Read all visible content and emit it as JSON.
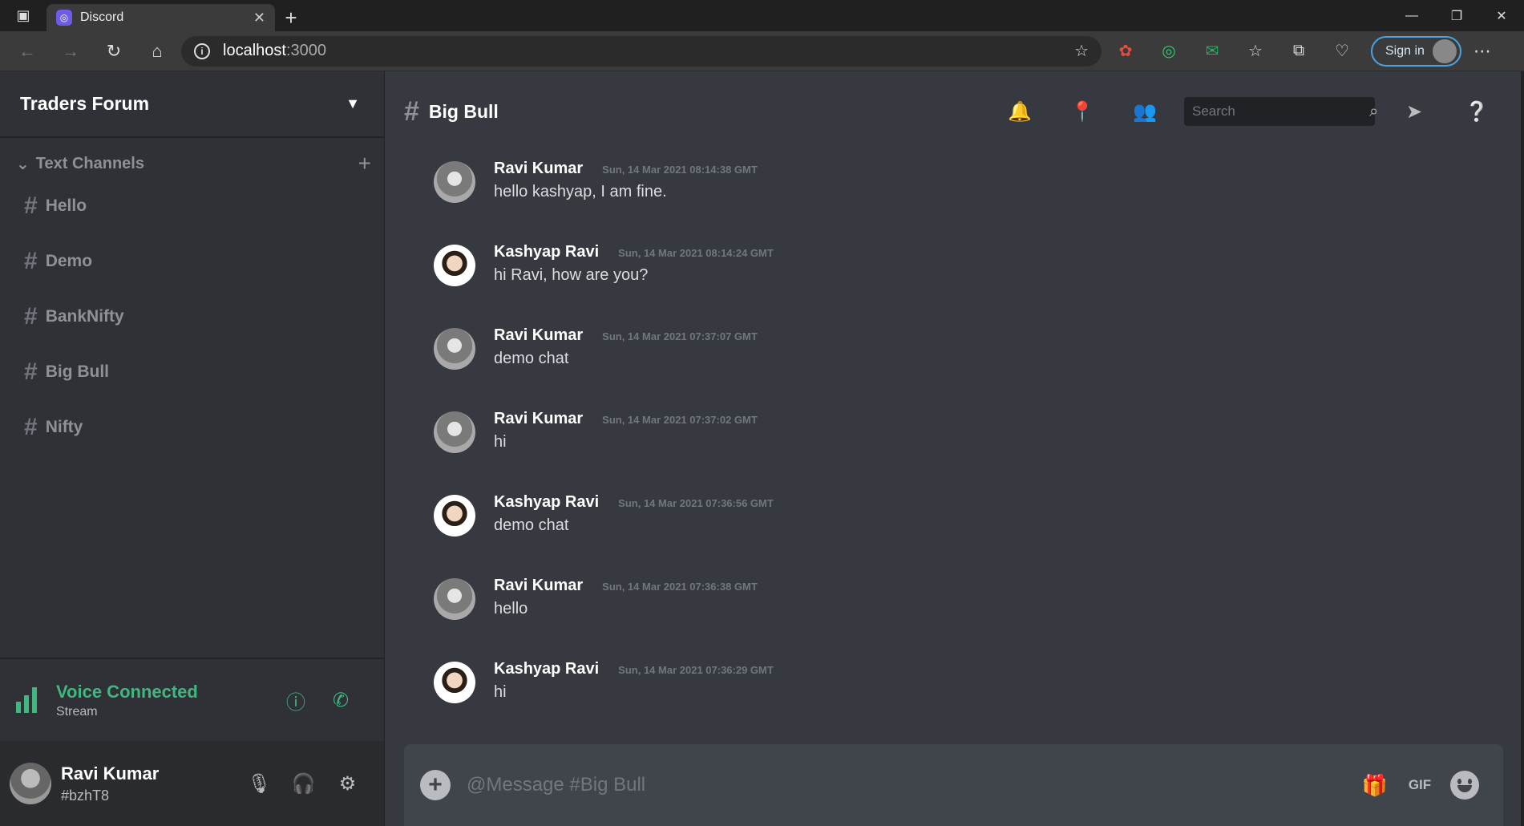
{
  "browser": {
    "tab_title": "Discord",
    "url_host": "localhost",
    "url_port": ":3000",
    "signin_label": "Sign in"
  },
  "server": {
    "name": "Traders Forum"
  },
  "sidebar": {
    "category": "Text Channels",
    "channels": [
      {
        "label": "Hello"
      },
      {
        "label": "Demo"
      },
      {
        "label": "BankNifty"
      },
      {
        "label": "Big Bull"
      },
      {
        "label": "Nifty"
      }
    ]
  },
  "voice": {
    "title": "Voice Connected",
    "subtitle": "Stream",
    "accent": "#43b581"
  },
  "user": {
    "name": "Ravi Kumar",
    "tag": "#bzhT8"
  },
  "chat": {
    "channel_title": "Big Bull",
    "search_placeholder": "Search",
    "composer_placeholder": "@Message #Big Bull",
    "gif_label": "GIF",
    "messages": [
      {
        "author": "Ravi Kumar",
        "time": "Sun, 14 Mar 2021 08:14:38 GMT",
        "text": "hello kashyap, I am fine.",
        "avatar": "ravi"
      },
      {
        "author": "Kashyap Ravi",
        "time": "Sun, 14 Mar 2021 08:14:24 GMT",
        "text": "hi Ravi, how are you?",
        "avatar": "kashyap"
      },
      {
        "author": "Ravi Kumar",
        "time": "Sun, 14 Mar 2021 07:37:07 GMT",
        "text": "demo chat",
        "avatar": "ravi"
      },
      {
        "author": "Ravi Kumar",
        "time": "Sun, 14 Mar 2021 07:37:02 GMT",
        "text": "hi",
        "avatar": "ravi"
      },
      {
        "author": "Kashyap Ravi",
        "time": "Sun, 14 Mar 2021 07:36:56 GMT",
        "text": "demo chat",
        "avatar": "kashyap"
      },
      {
        "author": "Ravi Kumar",
        "time": "Sun, 14 Mar 2021 07:36:38 GMT",
        "text": "hello",
        "avatar": "ravi"
      },
      {
        "author": "Kashyap Ravi",
        "time": "Sun, 14 Mar 2021 07:36:29 GMT",
        "text": "hi",
        "avatar": "kashyap"
      }
    ]
  },
  "colors": {
    "sidebar_bg": "#2f3136",
    "main_bg": "#36393f",
    "composer_bg": "#40444b"
  }
}
